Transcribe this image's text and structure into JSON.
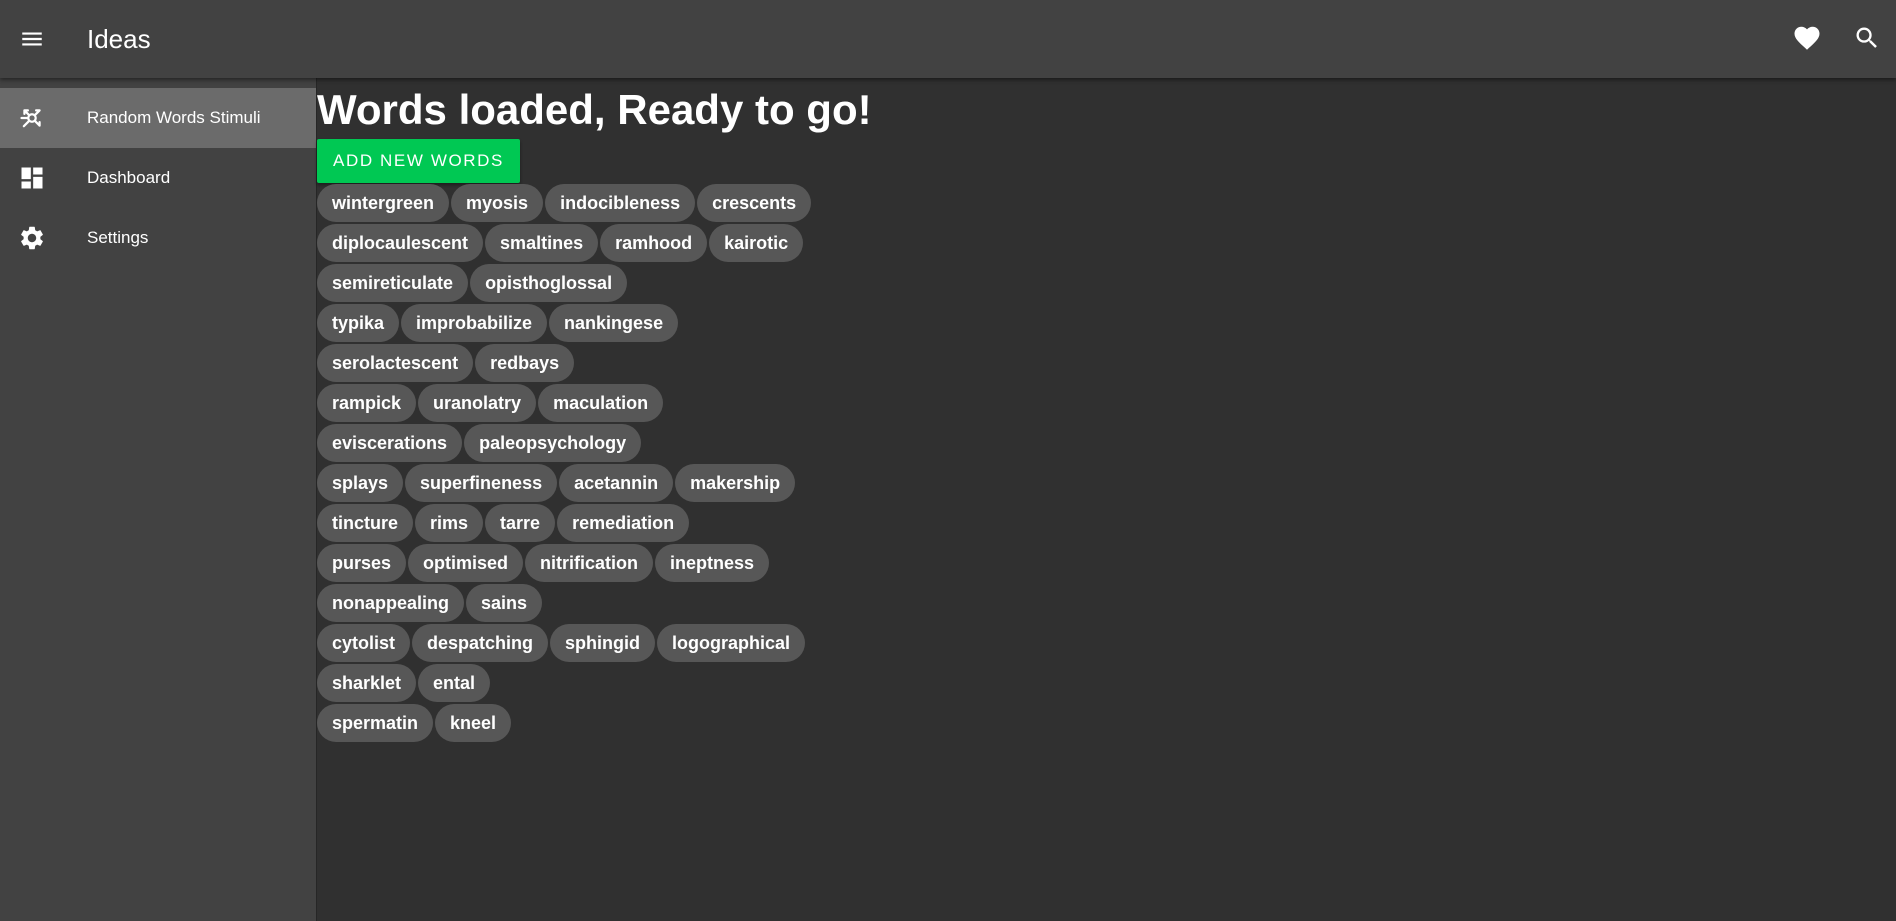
{
  "appbar": {
    "title": "Ideas",
    "icons": [
      "menu-icon",
      "heart-icon",
      "search-icon"
    ]
  },
  "drawer": {
    "items": [
      {
        "label": "Random Words Stimuli",
        "icon": "random-words-icon",
        "active": true
      },
      {
        "label": "Dashboard",
        "icon": "dashboard-icon",
        "active": false
      },
      {
        "label": "Settings",
        "icon": "gear-icon",
        "active": false
      }
    ]
  },
  "main": {
    "heading": "Words loaded, Ready to go!",
    "add_button_label": "ADD NEW WORDS",
    "word_rows": [
      [
        "wintergreen",
        "myosis",
        "indocibleness",
        "crescents"
      ],
      [
        "diplocaulescent",
        "smaltines",
        "ramhood",
        "kairotic"
      ],
      [
        "semireticulate",
        "opisthoglossal"
      ],
      [
        "typika",
        "improbabilize",
        "nankingese"
      ],
      [
        "serolactescent",
        "redbays"
      ],
      [
        "rampick",
        "uranolatry",
        "maculation"
      ],
      [
        "eviscerations",
        "paleopsychology"
      ],
      [
        "splays",
        "superfineness",
        "acetannin",
        "makership"
      ],
      [
        "tincture",
        "rims",
        "tarre",
        "remediation"
      ],
      [
        "purses",
        "optimised",
        "nitrification",
        "ineptness"
      ],
      [
        "nonappealing",
        "sains"
      ],
      [
        "cytolist",
        "despatching",
        "sphingid",
        "logographical"
      ],
      [
        "sharklet",
        "ental"
      ],
      [
        "spermatin",
        "kneel"
      ]
    ]
  },
  "colors": {
    "background": "#303030",
    "appbar": "#424242",
    "drawer": "#424242",
    "drawer_active": "#6b6b6b",
    "chip": "#575757",
    "accent_button": "#00c853",
    "text": "#ffffff"
  }
}
